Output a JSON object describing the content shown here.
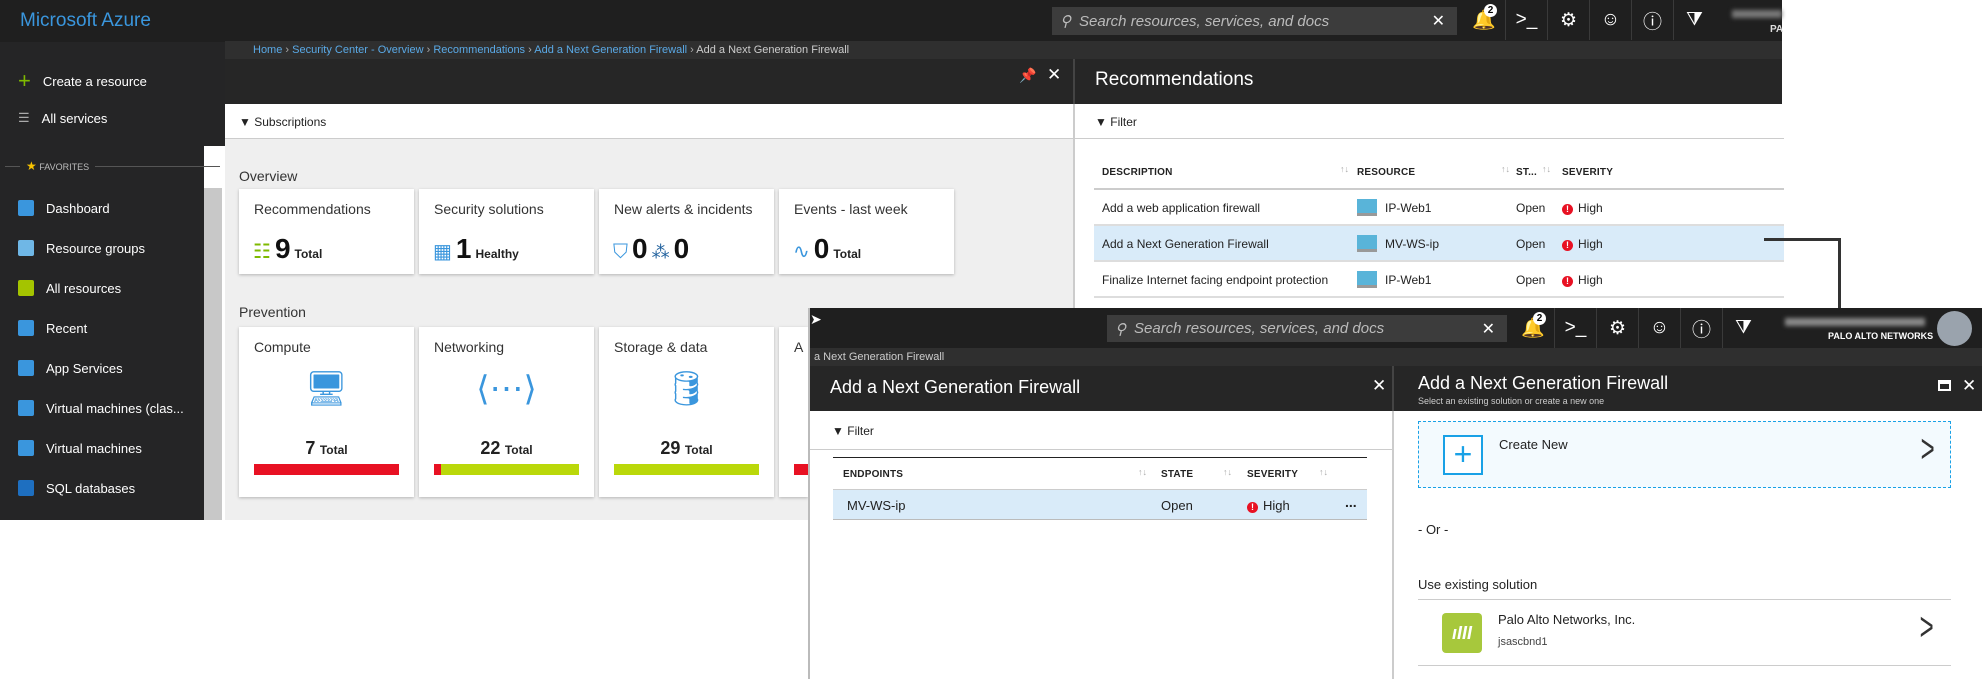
{
  "app_title": "Microsoft Azure",
  "search_placeholder": "Search resources, services, and docs",
  "notifications_count": "2",
  "account": {
    "directory": "PALO ALTO NETWORKS",
    "directory_truncated": "PA"
  },
  "sidebar": {
    "create": "Create a resource",
    "all_services": "All services",
    "favorites": "FAVORITES",
    "items": [
      {
        "label": "Dashboard",
        "icon": "dashboard-icon",
        "color": "#3a96dd"
      },
      {
        "label": "Resource groups",
        "icon": "resource-groups-icon",
        "color": "#6fb7e6"
      },
      {
        "label": "All resources",
        "icon": "all-resources-icon",
        "color": "#a4c400"
      },
      {
        "label": "Recent",
        "icon": "clock-icon",
        "color": "#3a96dd"
      },
      {
        "label": "App Services",
        "icon": "app-services-icon",
        "color": "#3a96dd"
      },
      {
        "label": "Virtual machines (clas...",
        "icon": "vm-classic-icon",
        "color": "#3a96dd"
      },
      {
        "label": "Virtual machines",
        "icon": "vm-icon",
        "color": "#3a96dd"
      },
      {
        "label": "SQL databases",
        "icon": "sql-icon",
        "color": "#1e6fc0"
      }
    ]
  },
  "breadcrumb": [
    "Home",
    "Security Center - Overview",
    "Recommendations",
    "Add a Next Generation Firewall",
    "Add a Next Generation Firewall"
  ],
  "security": {
    "subscriptions": "Subscriptions",
    "overview_label": "Overview",
    "overview": [
      {
        "title": "Recommendations",
        "value": "9",
        "unit": "Total"
      },
      {
        "title": "Security solutions",
        "value": "1",
        "unit": "Healthy"
      },
      {
        "title": "New alerts & incidents",
        "value": "0",
        "value2": "0"
      },
      {
        "title": "Events - last week",
        "value": "0",
        "unit": "Total"
      }
    ],
    "prevention_label": "Prevention",
    "prevention": [
      {
        "title": "Compute",
        "value": "7",
        "unit": "Total",
        "red_fraction": 1.0
      },
      {
        "title": "Networking",
        "value": "22",
        "unit": "Total",
        "red_fraction": 0.05
      },
      {
        "title": "Storage & data",
        "value": "29",
        "unit": "Total",
        "red_fraction": 0.0
      },
      {
        "title": "A",
        "red_fraction": 1.0
      }
    ]
  },
  "recommendations": {
    "title": "Recommendations",
    "filter": "Filter",
    "columns": [
      "DESCRIPTION",
      "RESOURCE",
      "ST...",
      "SEVERITY"
    ],
    "rows": [
      {
        "description": "Add a web application firewall",
        "resource": "IP-Web1",
        "state": "Open",
        "severity": "High",
        "selected": false
      },
      {
        "description": "Add a Next Generation Firewall",
        "resource": "MV-WS-ip",
        "state": "Open",
        "severity": "High",
        "selected": true
      },
      {
        "description": "Finalize Internet facing endpoint protection",
        "resource": "IP-Web1",
        "state": "Open",
        "severity": "High",
        "selected": false
      }
    ]
  },
  "front": {
    "breadcrumb_tail": "a Next Generation Firewall",
    "left": {
      "title": "Add a Next Generation Firewall",
      "filter": "Filter",
      "columns": [
        "ENDPOINTS",
        "STATE",
        "SEVERITY"
      ],
      "row": {
        "endpoint": "MV-WS-ip",
        "state": "Open",
        "severity": "High",
        "more": "..."
      }
    },
    "right": {
      "title": "Add a Next Generation Firewall",
      "subtitle": "Select an existing solution or create a new one",
      "create_new": "Create New",
      "or": "- Or -",
      "use_existing": "Use existing solution",
      "solution": {
        "name": "Palo Alto Networks, Inc.",
        "id": "jsascbnd1"
      }
    }
  },
  "colors": {
    "accent": "#0078d7",
    "link": "#5aa9e6",
    "severity": "#e81123",
    "healthy": "#bad80a",
    "selected_row": "#d9ebf9"
  }
}
